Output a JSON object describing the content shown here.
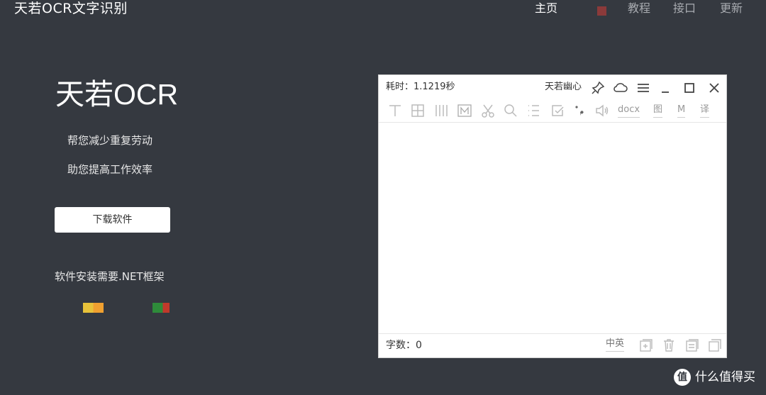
{
  "header": {
    "brand": "天若OCR文字识别",
    "nav": {
      "home": "主页",
      "tutorial": "教程",
      "api": "接口",
      "update": "更新"
    },
    "colors": {
      "active": "#ffffff",
      "inactive": "#a8abb0",
      "red_square": "#8b3a3a"
    }
  },
  "hero": {
    "title": "天若OCR",
    "tagline1": "帮您减少重复劳动",
    "tagline2": "助您提高工作效率",
    "download_label": "下载软件",
    "net_note": "软件安装需要.NET框架",
    "badge_colors": {
      "yellow": [
        "#e8c23a",
        "#f0a030"
      ],
      "green": [
        "#2e8b3a",
        "#c0392b"
      ]
    }
  },
  "app_window": {
    "title": "耗时：1.1219秒",
    "user": "天若幽心",
    "title_icons": [
      "pin-icon",
      "cloud-icon",
      "menu-icon",
      "minimize-icon",
      "maximize-icon",
      "close-icon"
    ],
    "toolbar": {
      "icons": [
        "text-merge-icon",
        "table-icon",
        "columns-icon",
        "m-box-icon",
        "cut-icon",
        "search-icon",
        "list-icon",
        "check-icon",
        "punctuation-icon",
        "speaker-icon"
      ],
      "docx": "docx",
      "tu": "图",
      "m": "M",
      "yi": "译"
    },
    "content": "",
    "status": {
      "char_count": "字数：0",
      "lang_toggle": "中英",
      "icons": [
        "add-file-icon",
        "trash-icon",
        "document-icon",
        "copy-icon"
      ]
    }
  },
  "watermark": {
    "glyph": "值",
    "text": "什么值得买"
  }
}
